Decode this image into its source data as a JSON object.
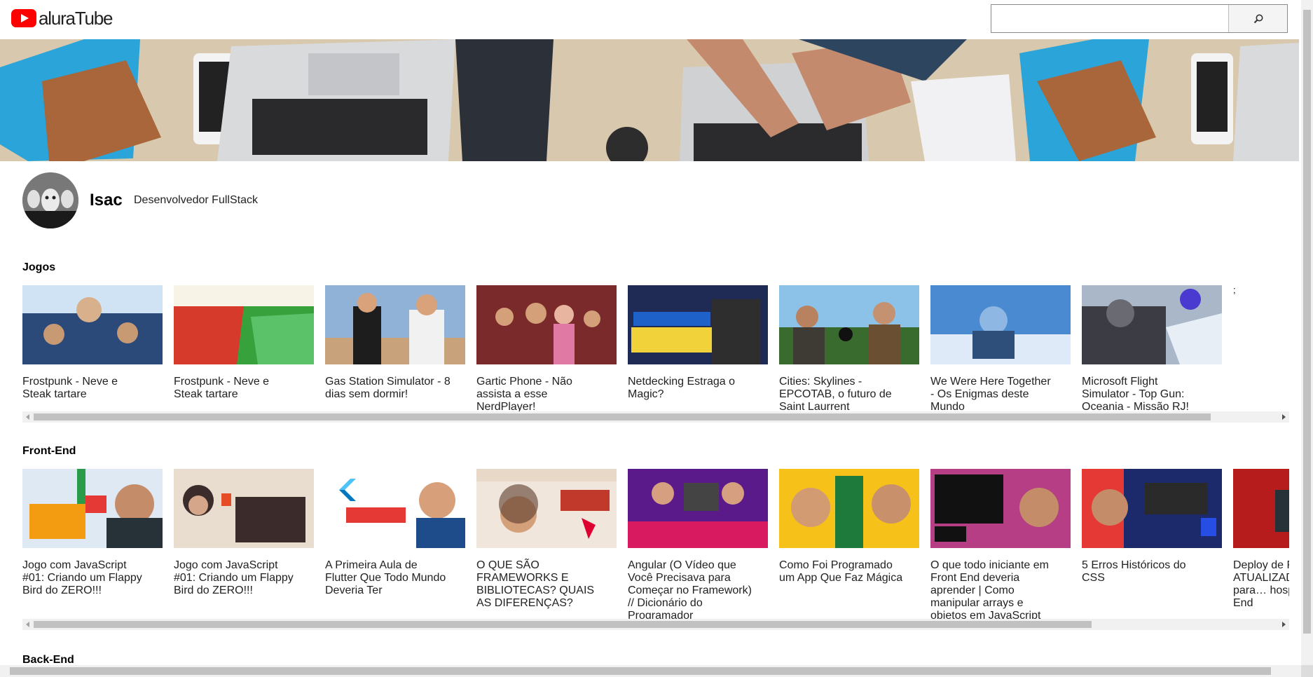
{
  "header": {
    "logo_text": "aluraTube",
    "search": {
      "value": "",
      "placeholder": ""
    },
    "search_button_icon": "search-icon"
  },
  "profile": {
    "name": "Isac",
    "job": "Desenvolvedor FullStack"
  },
  "sections": [
    {
      "title": "Jogos",
      "videos": [
        {
          "title": "Frostpunk - Neve e Steak tartare",
          "thumb_colors": [
            "#2b4a7a",
            "#cfe3f5"
          ]
        },
        {
          "title": "Frostpunk - Neve e Steak tartare",
          "thumb_colors": [
            "#d63a2a",
            "#37a13c"
          ]
        },
        {
          "title": "Gas Station Simulator - 8 dias sem dormir!",
          "thumb_colors": [
            "#8fb2d6",
            "#c7a27a"
          ]
        },
        {
          "title": "Gartic Phone - Não assista a esse NerdPlayer!",
          "thumb_colors": [
            "#7a2a2a",
            "#e07aa5"
          ]
        },
        {
          "title": "Netdecking Estraga o Magic?",
          "thumb_colors": [
            "#1f2a55",
            "#f2d23b"
          ]
        },
        {
          "title": "Cities: Skylines - EPCOTAB, o futuro de Saint Laurrent",
          "thumb_colors": [
            "#3a6b2e",
            "#8cc2e8"
          ]
        },
        {
          "title": "We Were Here Together - Os Enigmas deste Mundo",
          "thumb_colors": [
            "#4a8ad0",
            "#dfeaf8"
          ]
        },
        {
          "title": "Microsoft Flight Simulator - Top Gun: Oceania - Missão RJ!",
          "thumb_colors": [
            "#3c3c44",
            "#a9b7c9"
          ]
        }
      ],
      "extra_text": ";"
    },
    {
      "title": "Front-End",
      "videos": [
        {
          "title": "Jogo com JavaScript #01: Criando um Flappy Bird do ZERO!!!",
          "thumb_colors": [
            "#2a9b48",
            "#f39c12"
          ]
        },
        {
          "title": "Jogo com JavaScript #01: Criando um Flappy Bird do ZERO!!!",
          "thumb_colors": [
            "#e9ddd0",
            "#3b2b2b"
          ]
        },
        {
          "title": "A Primeira Aula de Flutter Que Todo Mundo Deveria Ter",
          "thumb_colors": [
            "#ffffff",
            "#4fc3f7"
          ]
        },
        {
          "title": "O QUE SÃO FRAMEWORKS E BIBLIOTECAS? QUAIS AS DIFERENÇAS?",
          "thumb_colors": [
            "#f0e6dc",
            "#c0392b"
          ]
        },
        {
          "title": "Angular (O Vídeo que Você Precisava para Começar no Framework) // Dicionário do Programador",
          "thumb_colors": [
            "#d81b60",
            "#5b1a8a"
          ]
        },
        {
          "title": "Como Foi Programado um App Que Faz Mágica",
          "thumb_colors": [
            "#f6c21a",
            "#1e7a3a"
          ]
        },
        {
          "title": "O que todo iniciante em Front End deveria aprender | Como manipular arrays e objetos em JavaScript",
          "thumb_colors": [
            "#8e24aa",
            "#ff7043"
          ]
        },
        {
          "title": "5 Erros Históricos do CSS",
          "thumb_colors": [
            "#1c2a6b",
            "#e53935"
          ]
        },
        {
          "title": "Deploy de F… ATUALIZAD… eu uso para… hospedagem… End",
          "thumb_colors": [
            "#b71c1c",
            "#263238"
          ]
        }
      ]
    },
    {
      "title": "Back-End",
      "videos": []
    }
  ],
  "colors": {
    "brand_red": "#ff0000",
    "scrollbar_track": "#f1f1f1",
    "scrollbar_thumb": "#c1c1c1"
  }
}
